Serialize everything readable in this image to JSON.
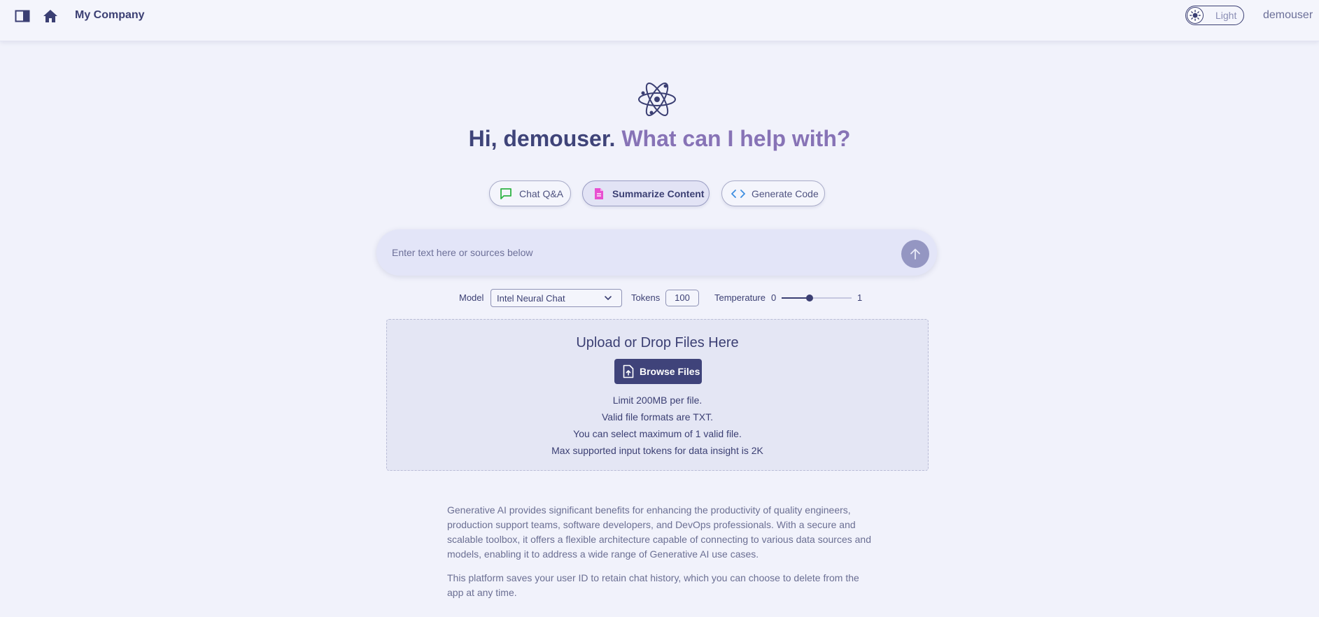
{
  "header": {
    "company_name": "My Company",
    "theme_toggle_label": "Light",
    "username": "demouser"
  },
  "hero": {
    "greeting_prefix": "Hi, demouser.",
    "greeting_question": "What can I help with?"
  },
  "modes": [
    {
      "label": "Chat Q&A",
      "icon": "chat-bubble-icon",
      "color": "#2fb344",
      "active": false
    },
    {
      "label": "Summarize Content",
      "icon": "document-icon",
      "color": "#e84fd0",
      "active": true
    },
    {
      "label": "Generate Code",
      "icon": "code-icon",
      "color": "#3e8ee0",
      "active": false
    }
  ],
  "prompt": {
    "placeholder": "Enter text here or sources below",
    "value": ""
  },
  "params": {
    "model_label": "Model",
    "model_value": "Intel Neural Chat",
    "tokens_label": "Tokens",
    "tokens_value": "100",
    "temperature_label": "Temperature",
    "temperature_min": "0",
    "temperature_max": "1",
    "temperature_value": 0.4
  },
  "upload": {
    "title": "Upload or Drop Files Here",
    "browse_label": "Browse Files",
    "notes": [
      "Limit 200MB per file.",
      "Valid file formats are TXT.",
      "You can select maximum of 1 valid file.",
      "Max supported input tokens for data insight is 2K"
    ]
  },
  "about": {
    "paragraph_1": "Generative AI provides significant benefits for enhancing the productivity of quality engineers, production support teams, software developers, and DevOps professionals. With a secure and scalable toolbox, it offers a flexible architecture capable of connecting to various data sources and models, enabling it to address a wide range of Generative AI use cases.",
    "paragraph_2": "This platform saves your user ID to retain chat history, which you can choose to delete from the app at any time."
  },
  "colors": {
    "primary": "#3b3f73",
    "accent_purple": "#8773b6",
    "background": "#f1f2fb"
  }
}
